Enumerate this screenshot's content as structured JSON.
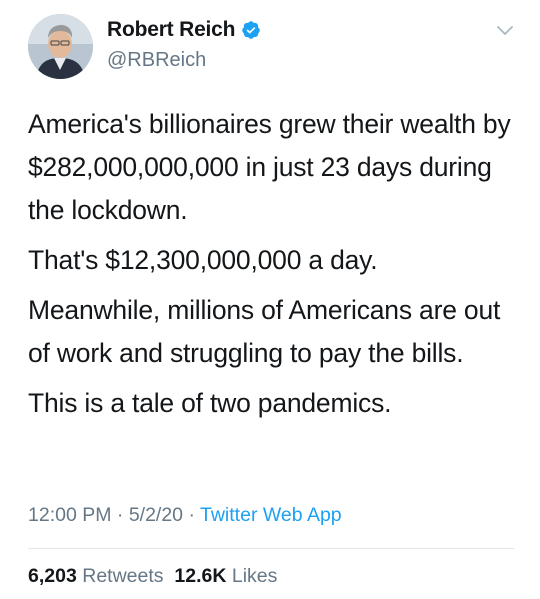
{
  "author": {
    "display_name": "Robert Reich",
    "handle": "@RBReich",
    "verified_icon": "verified-badge-icon",
    "avatar_icon": "profile-photo"
  },
  "menu": {
    "icon": "chevron-down-icon"
  },
  "tweet": {
    "paragraphs": [
      "America's billionaires grew their wealth by $282,000,000,000 in just 23 days during the lockdown.",
      "That's $12,300,000,000 a day.",
      "Meanwhile, millions of Americans are out of work and struggling to pay the bills.",
      "This is a tale of two pandemics."
    ]
  },
  "meta": {
    "time": "12:00 PM",
    "date": "5/2/20",
    "source": "Twitter Web App",
    "separator": " · "
  },
  "stats": {
    "retweets_count": "6,203",
    "retweets_label": "Retweets",
    "likes_count": "12.6K",
    "likes_label": "Likes"
  },
  "colors": {
    "text": "#14171a",
    "secondary": "#657786",
    "link": "#1da1f2",
    "divider": "#e1e8ed",
    "verified": "#1da1f2"
  }
}
